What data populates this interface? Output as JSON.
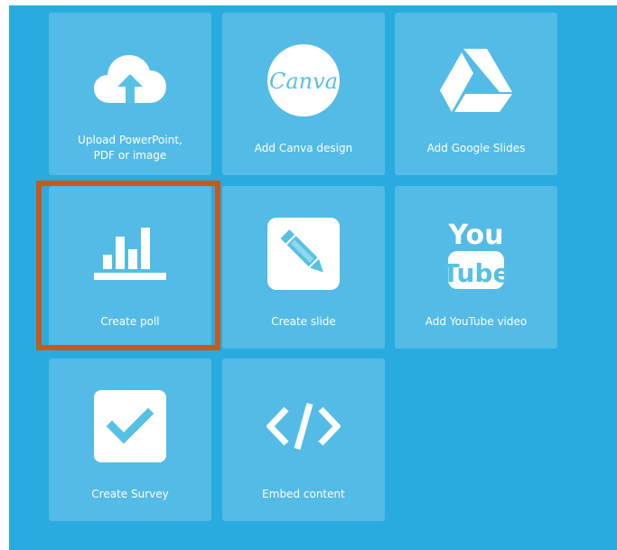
{
  "tiles": [
    {
      "id": "upload",
      "label": "Upload PowerPoint,\nPDF or image",
      "icon": "cloud-upload-icon"
    },
    {
      "id": "canva",
      "label": "Add Canva design",
      "icon": "canva-logo-icon",
      "icon_text": "Canva"
    },
    {
      "id": "google-slides",
      "label": "Add Google Slides",
      "icon": "google-drive-icon"
    },
    {
      "id": "poll",
      "label": "Create poll",
      "icon": "bar-chart-icon"
    },
    {
      "id": "slide",
      "label": "Create slide",
      "icon": "pencil-icon"
    },
    {
      "id": "youtube",
      "label": "Add YouTube video",
      "icon": "youtube-logo-icon",
      "icon_text_top": "You",
      "icon_text_bottom": "Tube"
    },
    {
      "id": "survey",
      "label": "Create Survey",
      "icon": "checkmark-icon"
    },
    {
      "id": "embed",
      "label": "Embed content",
      "icon": "code-icon"
    }
  ],
  "colors": {
    "background": "#29abe0",
    "tile": "rgba(255,255,255,0.2)",
    "highlight": "#c75a1a",
    "icon": "#ffffff"
  },
  "highlighted_tile": "poll"
}
